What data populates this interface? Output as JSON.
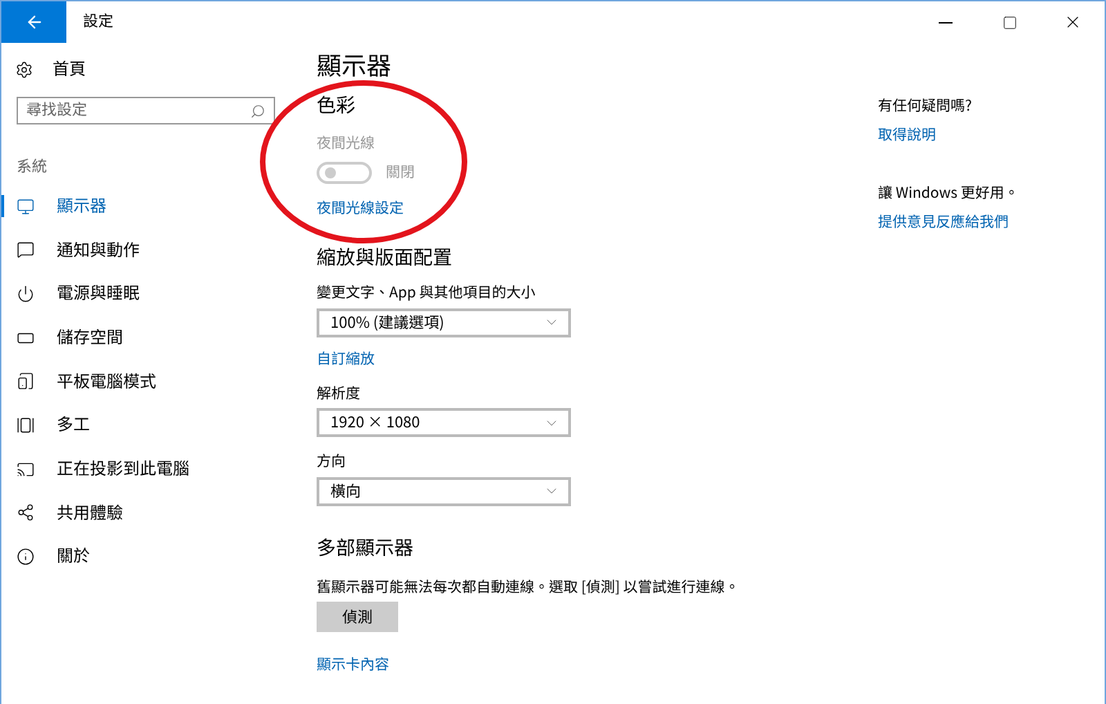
{
  "window": {
    "title": "設定"
  },
  "sidebar": {
    "home": "首頁",
    "search": {
      "placeholder": "尋找設定"
    },
    "section": "系統",
    "items": [
      {
        "label": "顯示器",
        "selected": true
      },
      {
        "label": "通知與動作",
        "selected": false
      },
      {
        "label": "電源與睡眠",
        "selected": false
      },
      {
        "label": "儲存空間",
        "selected": false
      },
      {
        "label": "平板電腦模式",
        "selected": false
      },
      {
        "label": "多工",
        "selected": false
      },
      {
        "label": "正在投影到此電腦",
        "selected": false
      },
      {
        "label": "共用體驗",
        "selected": false
      },
      {
        "label": "關於",
        "selected": false
      }
    ]
  },
  "main": {
    "title": "顯示器",
    "color_section": {
      "heading": "色彩",
      "night_light": {
        "label": "夜間光線",
        "on": false,
        "disabled": true,
        "state_text": "關閉"
      },
      "link": "夜間光線設定"
    },
    "scale_section": {
      "heading": "縮放與版面配置",
      "fields": [
        {
          "label": "變更文字、App 與其他項目的大小",
          "value": "100% (建議選項)",
          "link": "自訂縮放"
        },
        {
          "label": "解析度",
          "value": "1920 × 1080"
        },
        {
          "label": "方向",
          "value": "橫向"
        }
      ]
    },
    "multi_section": {
      "heading": "多部顯示器",
      "text": "舊顯示器可能無法每次都自動連線。選取 [偵測] 以嘗試進行連線。",
      "button": "偵測",
      "link": "顯示卡內容"
    }
  },
  "help": {
    "question": "有任何疑問嗎?",
    "link": "取得說明",
    "feedback_text": "讓 Windows 更好用。",
    "feedback_link": "提供意見反應給我們"
  }
}
